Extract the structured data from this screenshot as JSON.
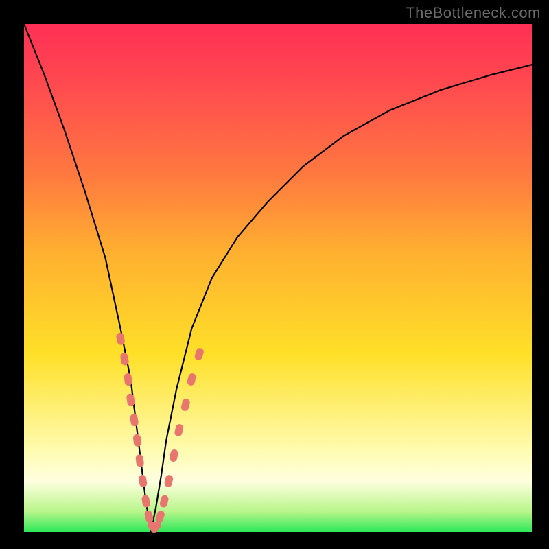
{
  "watermark": "TheBottleneck.com",
  "colors": {
    "frame": "#000000",
    "curve": "#000000",
    "marker_fill": "#e8766e",
    "marker_stroke": "#c95b53"
  },
  "chart_data": {
    "type": "line",
    "title": "",
    "xlabel": "",
    "ylabel": "",
    "xlim": [
      0,
      100
    ],
    "ylim": [
      0,
      100
    ],
    "note": "V-shaped bottleneck curve; x and y in percent of plot area; minimum near x≈25",
    "series": [
      {
        "name": "bottleneck-curve",
        "x": [
          0,
          4,
          8,
          12,
          16,
          19,
          21,
          22,
          23,
          24,
          25,
          26,
          27,
          28,
          30,
          33,
          37,
          42,
          48,
          55,
          63,
          72,
          82,
          92,
          100
        ],
        "y": [
          100,
          90,
          79,
          67,
          54,
          40,
          30,
          22,
          14,
          6,
          0,
          5,
          11,
          18,
          28,
          40,
          50,
          58,
          65,
          72,
          78,
          83,
          87,
          90,
          92
        ]
      }
    ],
    "markers": {
      "name": "highlight-points",
      "note": "pink oblong markers clustered near the valley on both arms",
      "points": [
        {
          "x": 19.0,
          "y": 38
        },
        {
          "x": 19.8,
          "y": 34
        },
        {
          "x": 20.5,
          "y": 30
        },
        {
          "x": 21.0,
          "y": 26
        },
        {
          "x": 21.7,
          "y": 22
        },
        {
          "x": 22.3,
          "y": 18
        },
        {
          "x": 22.8,
          "y": 14
        },
        {
          "x": 23.4,
          "y": 10
        },
        {
          "x": 24.0,
          "y": 6
        },
        {
          "x": 24.6,
          "y": 3
        },
        {
          "x": 25.3,
          "y": 1
        },
        {
          "x": 26.0,
          "y": 1
        },
        {
          "x": 26.8,
          "y": 3
        },
        {
          "x": 27.6,
          "y": 6
        },
        {
          "x": 28.5,
          "y": 10
        },
        {
          "x": 29.5,
          "y": 15
        },
        {
          "x": 30.5,
          "y": 20
        },
        {
          "x": 31.8,
          "y": 25
        },
        {
          "x": 33.0,
          "y": 30
        },
        {
          "x": 34.5,
          "y": 35
        }
      ]
    }
  }
}
